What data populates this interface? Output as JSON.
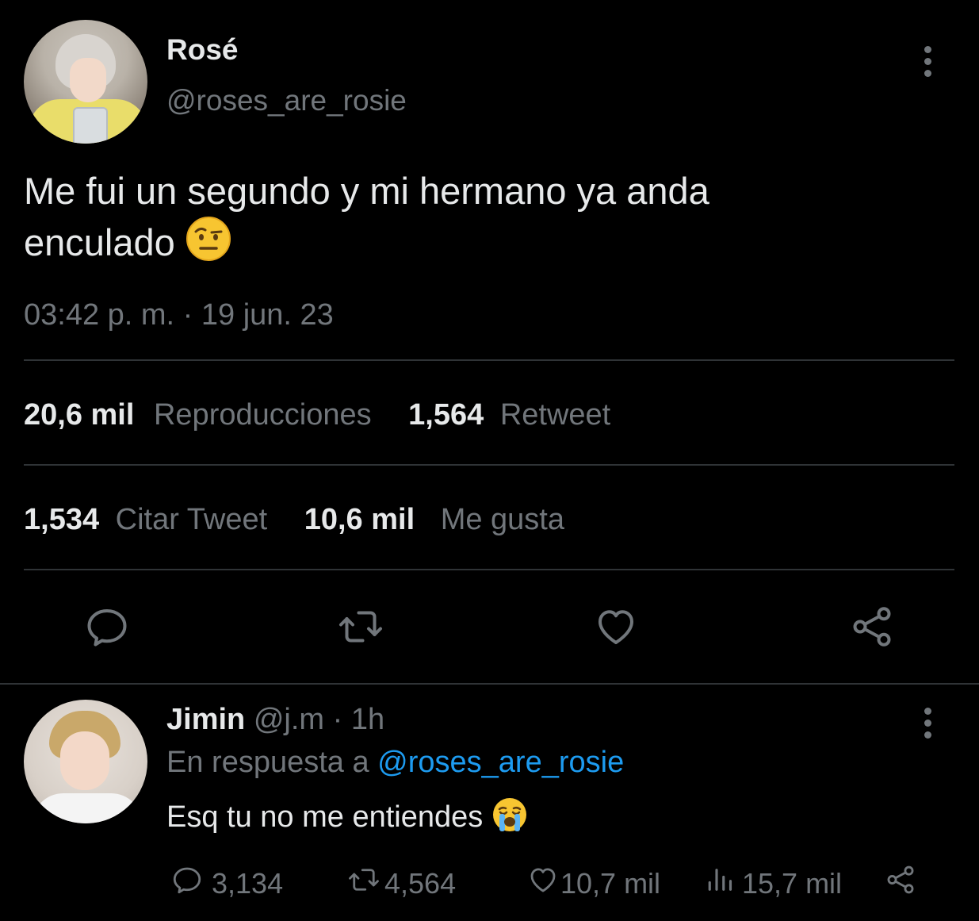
{
  "tweet": {
    "display_name": "Rosé",
    "handle": "@roses_are_rosie",
    "text_line1": "Me fui un segundo y mi hermano ya anda",
    "text_line2": "enculado",
    "emoji_icon": "raised-eyebrow-emoji",
    "timestamp": "03:42 p. m. · 19 jun. 23",
    "stats": {
      "views_count": "20,6 mil",
      "views_label": "Reproducciones",
      "retweets_count": "1,564",
      "retweets_label": "Retweet",
      "quotes_count": "1,534",
      "quotes_label": "Citar Tweet",
      "likes_count": "10,6 mil",
      "likes_label": "Me gusta"
    },
    "actions": [
      "reply-icon",
      "retweet-icon",
      "like-icon",
      "share-icon"
    ]
  },
  "reply": {
    "display_name": "Jimin",
    "handle": "@j.m",
    "time": "· 1h",
    "in_reply_to_label": "En respuesta a",
    "in_reply_to_handle": "@roses_are_rosie",
    "text": "Esq tu no me entiendes",
    "emoji_icon": "loudly-crying-emoji",
    "counts": {
      "replies": "3,134",
      "retweets": "4,564",
      "likes": "10,7 mil",
      "views": "15,7 mil"
    }
  },
  "colors": {
    "background": "#000000",
    "text_primary": "#e7e9ea",
    "text_secondary": "#71767b",
    "link": "#1d9bf0",
    "divider": "#2f3336"
  }
}
